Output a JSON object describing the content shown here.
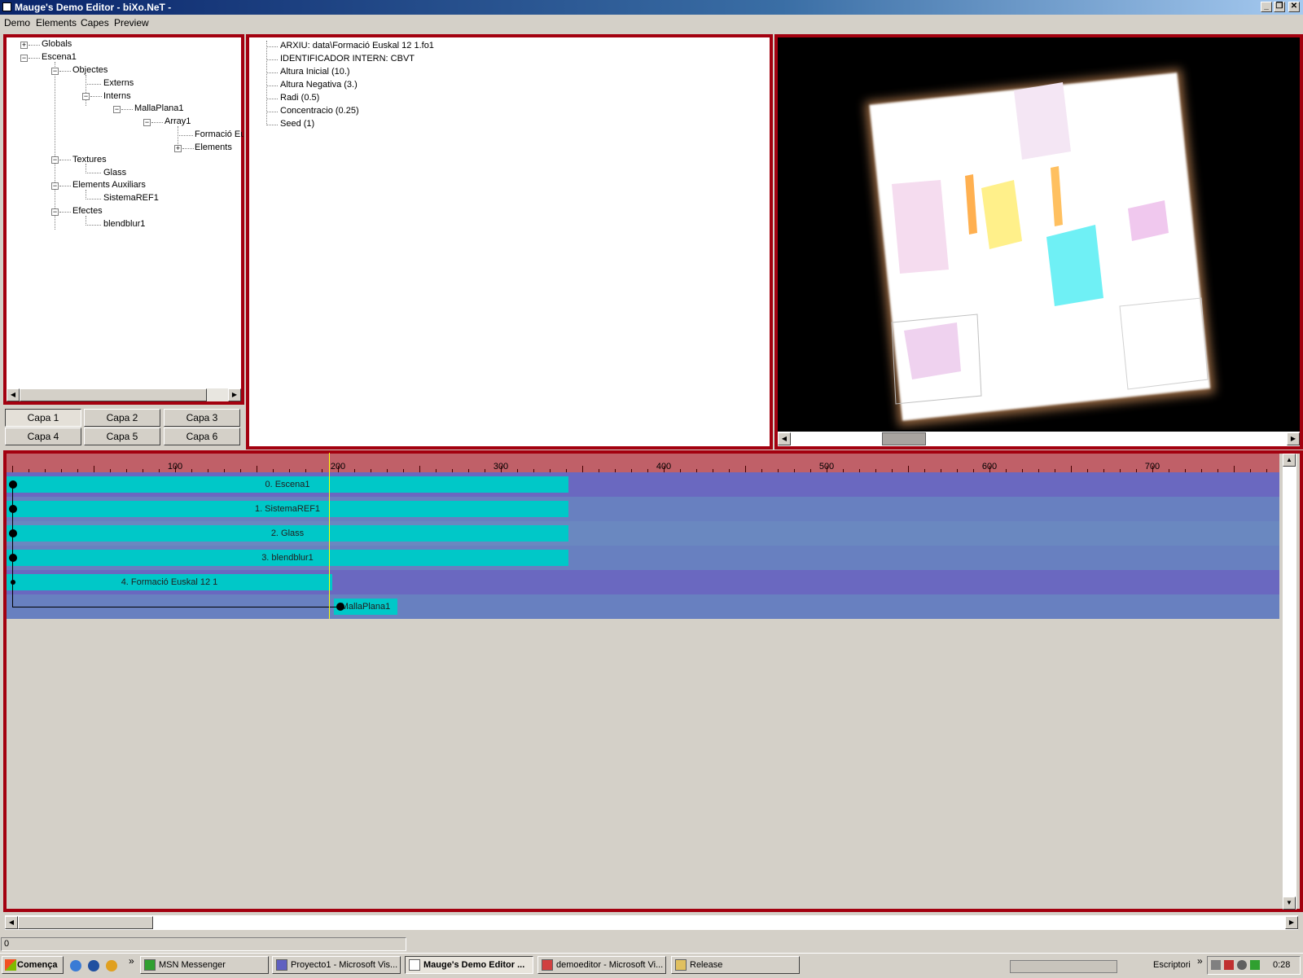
{
  "window": {
    "title": "Mauge's Demo Editor - biXo.NeT -"
  },
  "menu": [
    "Demo",
    "Elements",
    "Capes",
    "Preview"
  ],
  "tree": {
    "globals": "Globals",
    "escena": "Escena1",
    "objectes": "Objectes",
    "externs": "Externs",
    "interns": "Interns",
    "malla": "MallaPlana1",
    "array": "Array1",
    "formacio": "Formació Eu",
    "elements": "Elements",
    "textures": "Textures",
    "glass": "Glass",
    "auxiliars": "Elements Auxiliars",
    "sistema": "SistemaREF1",
    "efectes": "Efectes",
    "blendblur": "blendblur1"
  },
  "layers": [
    "Capa 1",
    "Capa 2",
    "Capa 3",
    "Capa 4",
    "Capa 5",
    "Capa 6"
  ],
  "properties": [
    "ARXIU: data\\Formació Euskal 12 1.fo1",
    "IDENTIFICADOR INTERN: CBVT",
    "Altura Inicial (10.)",
    "Altura Negativa (3.)",
    "Radi (0.5)",
    "Concentracio (0.25)",
    "Seed (1)"
  ],
  "timeline": {
    "ruler_labels": [
      "100",
      "200",
      "300",
      "400",
      "500",
      "600",
      "700"
    ],
    "tracks": [
      {
        "label": "0. Escena1",
        "start": 0,
        "end": 345
      },
      {
        "label": "1. SistemaREF1",
        "start": 0,
        "end": 345
      },
      {
        "label": "2. Glass",
        "start": 0,
        "end": 345
      },
      {
        "label": "3. blendblur1",
        "start": 0,
        "end": 345
      },
      {
        "label": "4. Formació Euskal 12 1",
        "start": 0,
        "end": 200
      },
      {
        "label": "MallaPlana1",
        "start": 200,
        "end": 240
      }
    ],
    "cursor": 200
  },
  "status": {
    "value": "0"
  },
  "taskbar": {
    "start": "Comença",
    "tasks": [
      "MSN Messenger",
      "Proyecto1 - Microsoft Vis...",
      "Mauge's Demo Editor ...",
      "demoeditor - Microsoft Vi...",
      "Release"
    ],
    "desktop": "Escriptori",
    "clock": "0:28"
  },
  "colors": {
    "frame": "#a3000f",
    "ruler": "#c06068",
    "bar": "#00c8c8",
    "track_a": "#6a68c0",
    "track_b": "#6880c0"
  }
}
